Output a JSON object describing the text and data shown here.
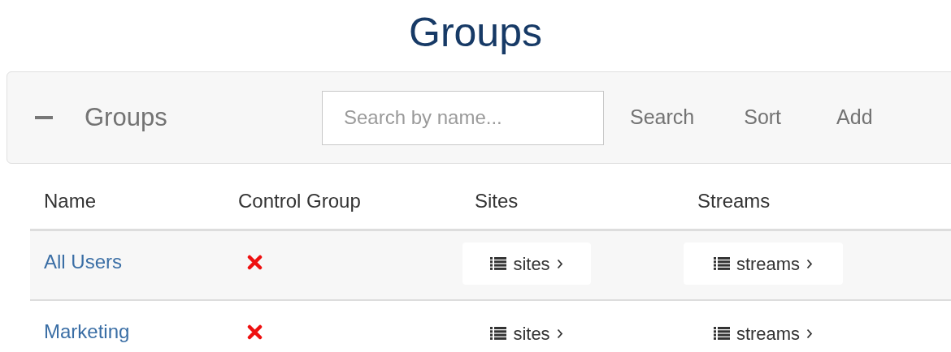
{
  "title": "Groups",
  "panel": {
    "expanded": true,
    "title": "Groups",
    "search": {
      "placeholder": "Search by name..."
    },
    "actions": [
      "Search",
      "Sort",
      "Add"
    ]
  },
  "table": {
    "columns": [
      "Name",
      "Control Group",
      "Sites",
      "Streams"
    ],
    "rows": [
      {
        "name": "All Users",
        "control_group": false,
        "sites": "sites",
        "streams": "streams"
      },
      {
        "name": "Marketing",
        "control_group": false,
        "sites": "sites",
        "streams": "streams"
      }
    ]
  }
}
